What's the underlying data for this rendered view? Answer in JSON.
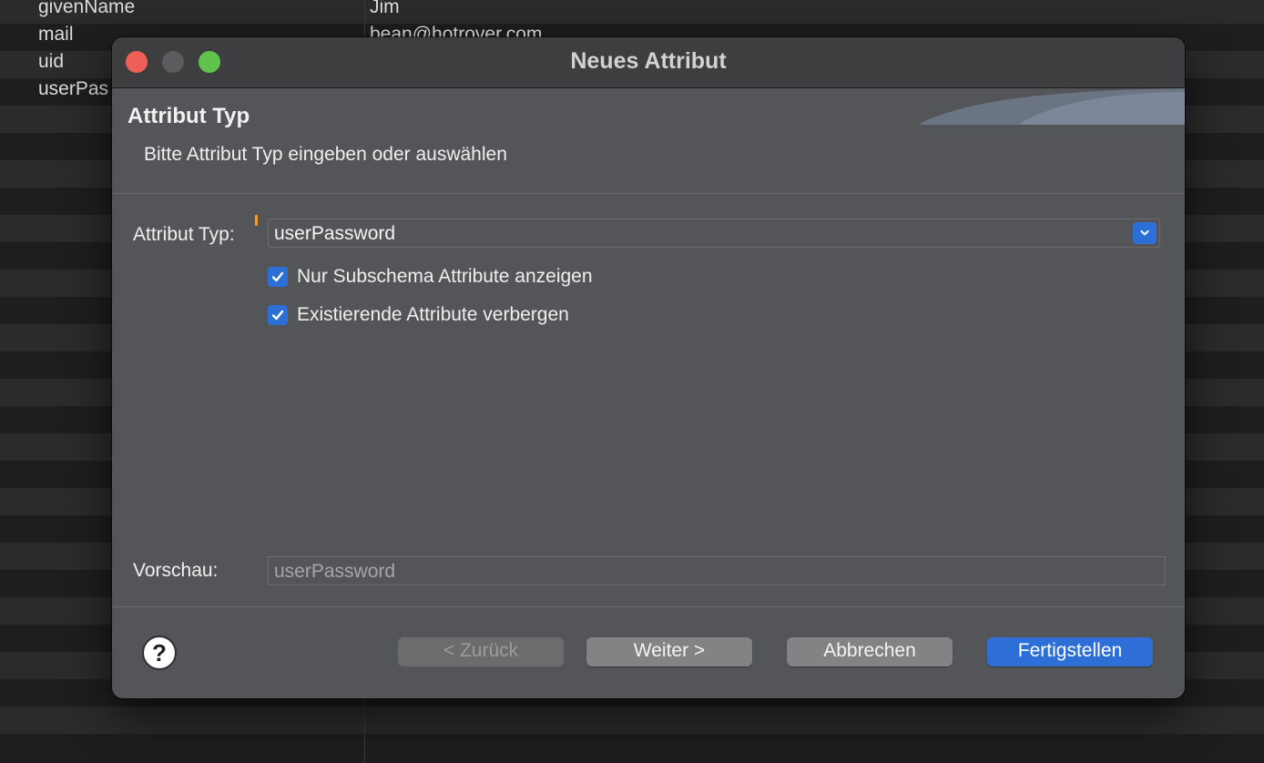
{
  "background_table": {
    "rows": [
      {
        "attribute": "givenName",
        "value": "Jim"
      },
      {
        "attribute": "mail",
        "value": "bean@hotrover.com"
      },
      {
        "attribute": "uid",
        "value": ""
      },
      {
        "attribute": "userPas",
        "value": ""
      }
    ]
  },
  "dialog": {
    "title": "Neues Attribut",
    "section_title": "Attribut Typ",
    "section_description": "Bitte Attribut Typ eingeben oder auswählen",
    "attribute_type": {
      "label": "Attribut Typ:",
      "value": "userPassword"
    },
    "checkboxes": [
      {
        "label": "Nur Subschema Attribute anzeigen",
        "checked": true
      },
      {
        "label": "Existierende Attribute verbergen",
        "checked": true
      }
    ],
    "preview": {
      "label": "Vorschau:",
      "value": "userPassword"
    },
    "buttons": {
      "help": "?",
      "back": "< Zurück",
      "next": "Weiter >",
      "cancel": "Abbrechen",
      "finish": "Fertigstellen"
    }
  },
  "colors": {
    "accent": "#2d6fd7",
    "close": "#ee5f57",
    "maximize": "#5fc34d",
    "dialog_bg": "#545558",
    "titlebar_bg": "#3e3e40"
  }
}
